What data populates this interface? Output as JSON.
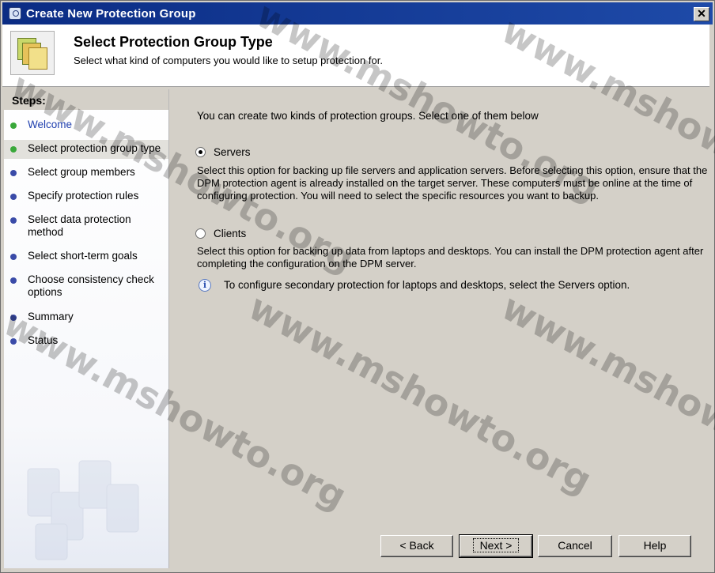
{
  "window": {
    "title": "Create New Protection Group",
    "close_glyph": "✕"
  },
  "header": {
    "title": "Select Protection Group Type",
    "subtitle": "Select what kind of computers you would like to setup protection for."
  },
  "steps": {
    "heading": "Steps:",
    "items": [
      {
        "label": "Welcome",
        "status": "completed"
      },
      {
        "label": "Select protection group type",
        "status": "current"
      },
      {
        "label": "Select group members",
        "status": "pending"
      },
      {
        "label": "Specify protection rules",
        "status": "pending"
      },
      {
        "label": "Select data protection method",
        "status": "pending"
      },
      {
        "label": "Select short-term goals",
        "status": "pending"
      },
      {
        "label": "Choose consistency check options",
        "status": "pending"
      },
      {
        "label": "Summary",
        "status": "pending"
      },
      {
        "label": "Status",
        "status": "pending"
      }
    ]
  },
  "main": {
    "intro": "You can create two kinds of protection groups. Select one of them below",
    "options": [
      {
        "label": "Servers",
        "selected": true,
        "description": "Select this option for backing up file servers and application servers. Before selecting this option, ensure that the DPM protection agent is already installed on the target server. These computers must be online at the time of configuring protection. You will need to select the specific resources you want to backup."
      },
      {
        "label": "Clients",
        "selected": false,
        "description": "Select this option for backing up data from laptops and desktops. You can install the DPM protection agent after completing the configuration on the DPM server."
      }
    ],
    "info_icon_glyph": "i",
    "info_note": "To configure secondary protection for laptops and desktops, select the Servers option."
  },
  "buttons": {
    "back": "< Back",
    "next": "Next >",
    "cancel": "Cancel",
    "help": "Help"
  },
  "watermark": "www.mshowto.org",
  "colors": {
    "titlebar": "#0b2c84",
    "step_done": "#39a83a",
    "step_pending": "#3a4ba8",
    "link": "#1f3fae"
  }
}
